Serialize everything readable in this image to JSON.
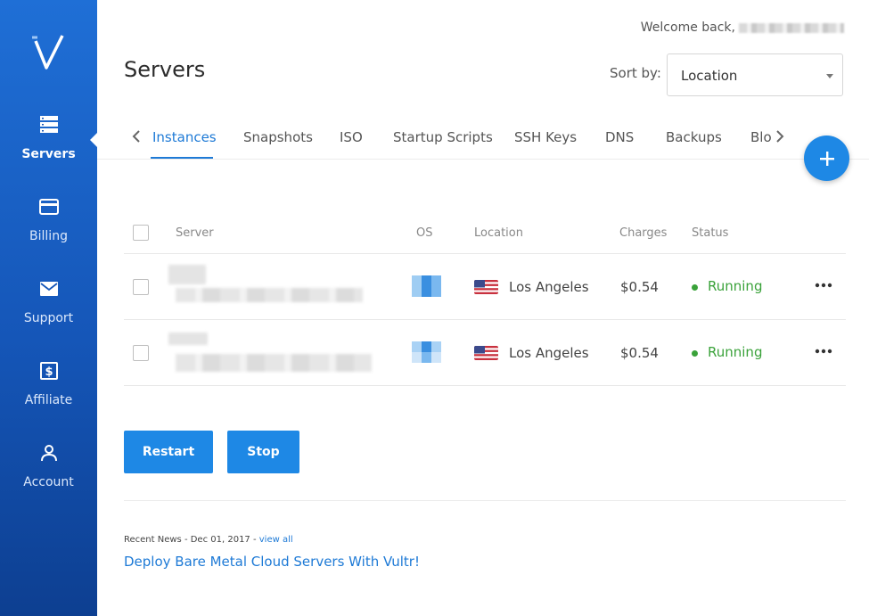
{
  "sidebar": {
    "items": [
      {
        "label": "Servers",
        "icon": "servers-icon",
        "active": true
      },
      {
        "label": "Billing",
        "icon": "credit-card-icon"
      },
      {
        "label": "Support",
        "icon": "envelope-icon"
      },
      {
        "label": "Affiliate",
        "icon": "dollar-icon"
      },
      {
        "label": "Account",
        "icon": "user-icon"
      }
    ]
  },
  "header": {
    "welcome": "Welcome back,",
    "title": "Servers",
    "sort_label": "Sort by:",
    "sort_value": "Location"
  },
  "tabs": [
    "Instances",
    "Snapshots",
    "ISO",
    "Startup Scripts",
    "SSH Keys",
    "DNS",
    "Backups",
    "Blo"
  ],
  "table": {
    "columns": [
      "Server",
      "OS",
      "Location",
      "Charges",
      "Status"
    ],
    "rows": [
      {
        "location": "Los Angeles",
        "charges": "$0.54",
        "status": "Running"
      },
      {
        "location": "Los Angeles",
        "charges": "$0.54",
        "status": "Running"
      }
    ]
  },
  "actions": {
    "restart": "Restart",
    "stop": "Stop"
  },
  "news": {
    "meta": "Recent News - Dec 01, 2017 -",
    "view_all": "view all",
    "title": "Deploy Bare Metal Cloud Servers With Vultr!"
  },
  "colors": {
    "accent": "#1e88e5",
    "sidebar": "#1556b8",
    "status_running": "#3aa23a"
  }
}
